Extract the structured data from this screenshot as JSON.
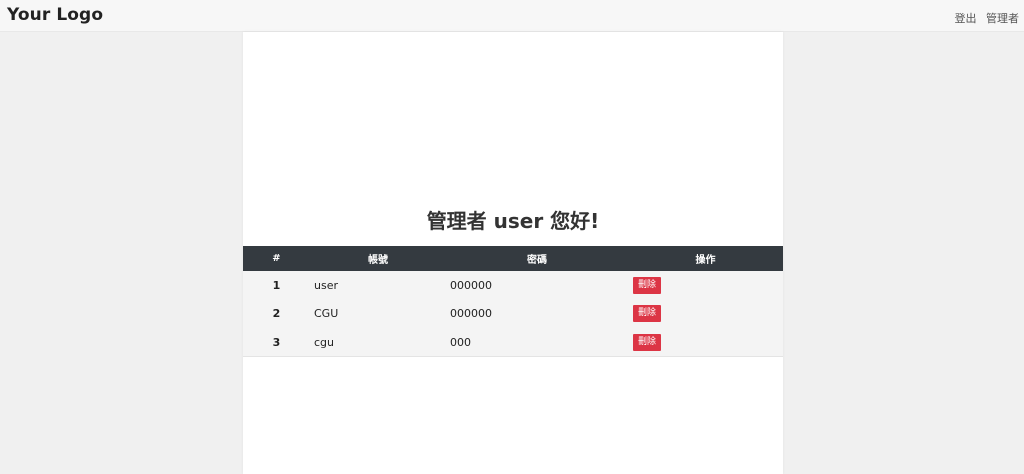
{
  "navbar": {
    "logo": "Your Logo",
    "logout_label": "登出",
    "admin_label": "管理者"
  },
  "main": {
    "welcome": "管理者 user 您好!",
    "table": {
      "headers": [
        "#",
        "帳號",
        "密碼",
        "操作"
      ],
      "rows": [
        {
          "num": "1",
          "account": "user",
          "password": "000000",
          "action": "刪除"
        },
        {
          "num": "2",
          "account": "CGU",
          "password": "000000",
          "action": "刪除"
        },
        {
          "num": "3",
          "account": "cgu",
          "password": "000",
          "action": "刪除"
        }
      ]
    }
  },
  "colors": {
    "header_bg": "#343a40",
    "delete_button": "#dc3545",
    "page_bg": "#f0f0f0"
  }
}
